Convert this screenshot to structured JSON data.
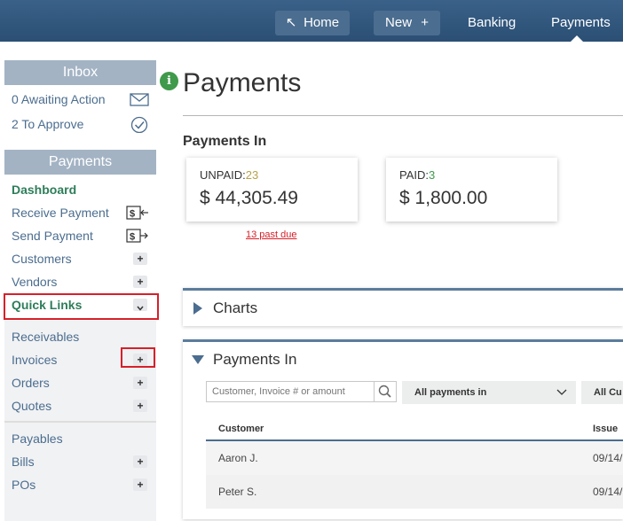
{
  "topnav": {
    "home_label": "Home",
    "new_label": "New",
    "banking_label": "Banking",
    "payments_label": "Payments"
  },
  "sidebar": {
    "inbox_title": "Inbox",
    "inbox_items": [
      {
        "label": "0 Awaiting Action",
        "icon": "envelope-icon"
      },
      {
        "label": "2 To Approve",
        "icon": "check-circle-icon"
      }
    ],
    "payments_title": "Payments",
    "payments_items": [
      {
        "label": "Dashboard"
      },
      {
        "label": "Receive Payment",
        "icon": "receive-payment-icon"
      },
      {
        "label": "Send Payment",
        "icon": "send-payment-icon"
      },
      {
        "label": "Customers"
      },
      {
        "label": "Vendors"
      },
      {
        "label": "Quick Links"
      }
    ],
    "receivables_items": [
      {
        "label": "Receivables"
      },
      {
        "label": "Invoices"
      },
      {
        "label": "Orders"
      },
      {
        "label": "Quotes"
      }
    ],
    "payables_items": [
      {
        "label": "Payables"
      },
      {
        "label": "Bills"
      },
      {
        "label": "POs"
      }
    ]
  },
  "main": {
    "page_title": "Payments",
    "section_title": "Payments In",
    "unpaid_label": "UNPAID:",
    "unpaid_count": "23",
    "unpaid_amount": "$ 44,305.49",
    "paid_label": "PAID:",
    "paid_count": "3",
    "paid_amount": "$ 1,800.00",
    "past_due": "13 past due",
    "charts_title": "Charts",
    "paymentsin_title": "Payments In",
    "search_placeholder": "Customer, Invoice # or amount",
    "filter1": "All payments in",
    "filter2": "All Cu",
    "columns": [
      "Customer",
      "Issue"
    ],
    "rows": [
      {
        "customer": "Aaron J.",
        "issue": "09/14/"
      },
      {
        "customer": "Peter S.",
        "issue": "09/14/"
      }
    ]
  },
  "colors": {
    "accent": "#4b6d8f",
    "active_green": "#2e7d5a",
    "highlight_red": "#d6202a",
    "topbar": "#2b4f74"
  }
}
